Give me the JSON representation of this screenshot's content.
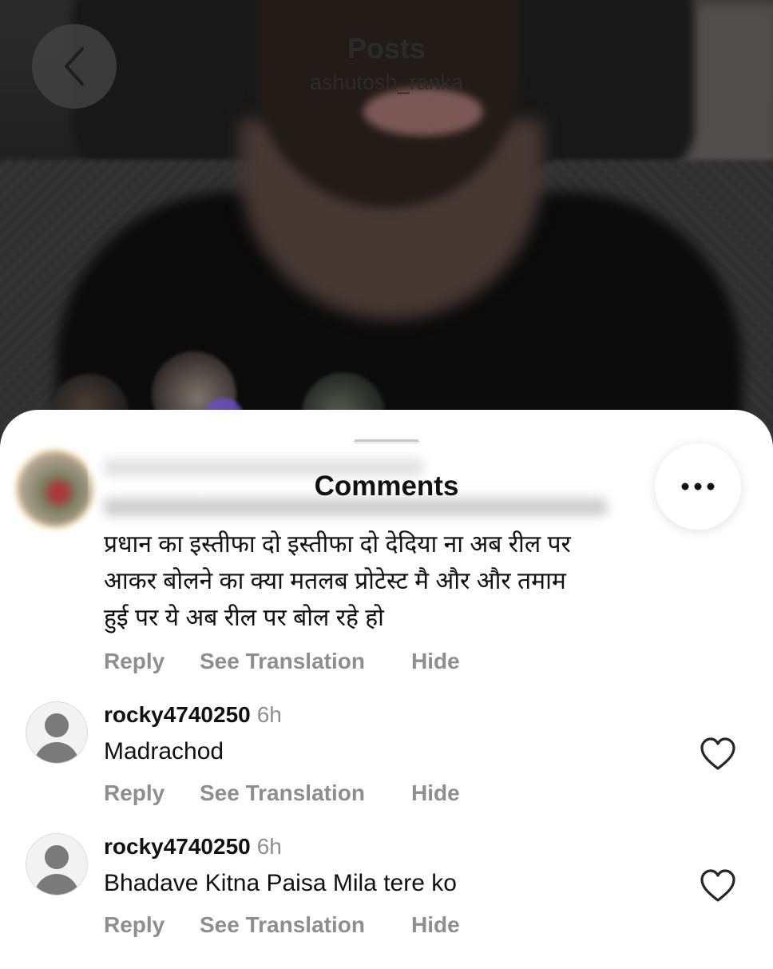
{
  "header": {
    "title": "Posts",
    "username": "ashutosh_ranka"
  },
  "sheet": {
    "title": "Comments"
  },
  "comments": [
    {
      "lines": [
        "प्रधान का इस्तीफा दो इस्तीफा दो देदिया ना अब रील पर",
        "आकर बोलने का क्या मतलब प्रोटेस्ट मै और और तमाम",
        "हुई पर ये अब रील पर बोल रहे हो"
      ],
      "actions": {
        "reply": "Reply",
        "translate": "See Translation",
        "hide": "Hide"
      }
    },
    {
      "username": "rocky4740250",
      "time": "6h",
      "text": "Madrachod",
      "actions": {
        "reply": "Reply",
        "translate": "See Translation",
        "hide": "Hide"
      }
    },
    {
      "username": "rocky4740250",
      "time": "6h",
      "text": "Bhadave Kitna Paisa Mila tere ko",
      "actions": {
        "reply": "Reply",
        "translate": "See Translation",
        "hide": "Hide"
      }
    }
  ],
  "icons": {
    "back": "chevron-left-icon",
    "more": "more-horizontal-icon",
    "like": "heart-outline-icon",
    "avatar": "default-avatar-icon"
  },
  "colors": {
    "sheet_bg": "#ffffff",
    "action_gray": "#8e8e8e",
    "text": "#111111"
  }
}
